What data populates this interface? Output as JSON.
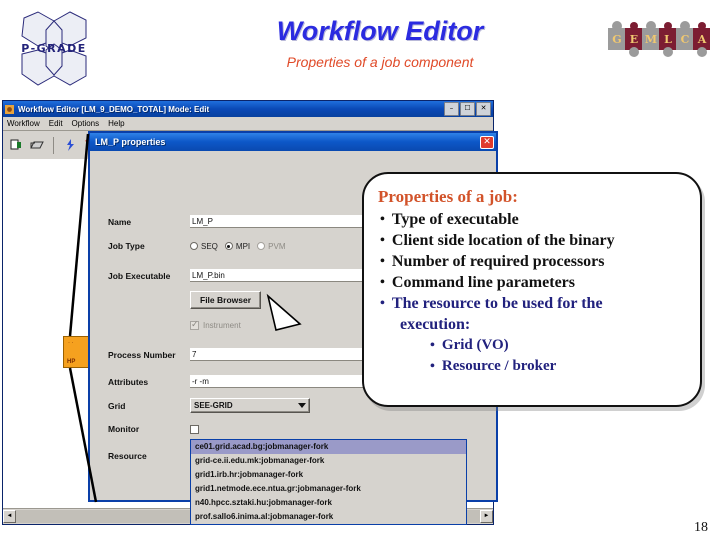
{
  "slide": {
    "title": "Workflow Editor",
    "subtitle": "Properties of a job component",
    "page_number": "18",
    "logo_left_text": "P-GRADE",
    "logo_right_letters": [
      "G",
      "E",
      "M",
      "L",
      "C",
      "A"
    ],
    "colors": {
      "title_blue": "#2b2be0",
      "subtitle_red": "#e04a28",
      "callout_heading": "#d2532a",
      "callout_navy": "#22227e",
      "node_orange": "#f5a11f"
    }
  },
  "app_window": {
    "title": "Workflow Editor  [LM_9_DEMO_TOTAL] Mode:  Edit",
    "title_icon": "app-icon",
    "window_buttons": [
      {
        "name": "minimize-button",
        "glyph": "–"
      },
      {
        "name": "maximize-button",
        "glyph": "☐"
      },
      {
        "name": "close-button",
        "glyph": "✕"
      }
    ],
    "menus": [
      "Workflow",
      "Edit",
      "Options",
      "Help"
    ],
    "toolbar_icons": [
      "new-workflow-icon",
      "open-workflow-icon",
      "run-workflow-icon",
      "delete-icon",
      "refresh-icon"
    ],
    "scrollbar": {
      "left_arrow": "◄",
      "right_arrow": "►"
    }
  },
  "workflow_node": {
    "label": "HP",
    "dots": "·  ·",
    "ports": [
      "output-port-green",
      "input-port-grey"
    ]
  },
  "dialog": {
    "title": "LM_P properties",
    "close_glyph": "✕",
    "fields": {
      "name": {
        "label": "Name",
        "value": "LM_P"
      },
      "job_type": {
        "label": "Job Type",
        "options": [
          {
            "label": "SEQ",
            "selected": false,
            "enabled": true
          },
          {
            "label": "MPI",
            "selected": true,
            "enabled": true
          },
          {
            "label": "PVM",
            "selected": false,
            "enabled": false
          }
        ]
      },
      "job_executable": {
        "label": "Job Executable",
        "value": "LM_P.bin"
      },
      "file_browser_button": "File Browser",
      "instrument": {
        "label": "Instrument",
        "checked": true,
        "enabled": false
      },
      "process_number": {
        "label": "Process Number",
        "value": "7"
      },
      "attributes": {
        "label": "Attributes",
        "value": "-r -m"
      },
      "grid": {
        "label": "Grid",
        "value": "SEE-GRID"
      },
      "monitor": {
        "label": "Monitor",
        "checked": false
      },
      "resource": {
        "label": "Resource",
        "value": "n40.hpcc.sztaki.hu:jobmanager-fork"
      }
    },
    "resource_options": [
      {
        "text": "ce01.grid.acad.bg:jobmanager-fork",
        "selected": true
      },
      {
        "text": "grid-ce.ii.edu.mk:jobmanager-fork",
        "selected": false
      },
      {
        "text": "grid1.irb.hr:jobmanager-fork",
        "selected": false
      },
      {
        "text": "grid1.netmode.ece.ntua.gr:jobmanager-fork",
        "selected": false
      },
      {
        "text": "n40.hpcc.sztaki.hu:jobmanager-fork",
        "selected": false
      },
      {
        "text": "prof.sallo6.inima.al:jobmanager-fork",
        "selected": false
      }
    ]
  },
  "callout": {
    "heading": "Properties of a job:",
    "bullet_char": "•",
    "items": [
      "Type of executable",
      "Client side location of the binary",
      "Number of required processors",
      "Command line parameters",
      "The resource to be used for the"
    ],
    "continuation": "execution:",
    "sub_items": [
      "Grid (VO)",
      "Resource / broker"
    ]
  }
}
